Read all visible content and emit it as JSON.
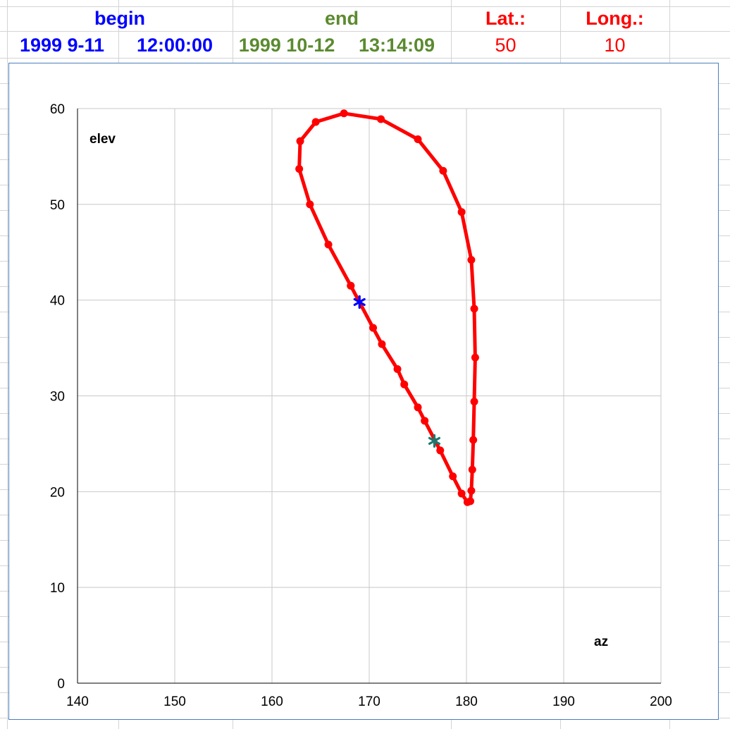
{
  "header": {
    "begin_label": "begin",
    "end_label": "end",
    "lat_label": "Lat.:",
    "long_label": "Long.:",
    "begin_date": "1999  9-11",
    "begin_time": "12:00:00",
    "end_date": "1999  10-12",
    "end_time": "13:14:09",
    "lat_value": "50",
    "long_value": "10"
  },
  "colors": {
    "begin": "#0000ff",
    "end": "#5b8a2f",
    "lat_long": "#ff0000",
    "series": "#ff0000",
    "begin_marker": "#0000ff",
    "end_marker": "#1a7a72",
    "plot_border": "#4a7ebb"
  },
  "chart_data": {
    "type": "scatter",
    "xlabel": "az",
    "ylabel": "elev",
    "xlim": [
      140,
      200
    ],
    "ylim": [
      0,
      60
    ],
    "xticks": [
      140,
      150,
      160,
      170,
      180,
      190,
      200
    ],
    "yticks": [
      0,
      10,
      20,
      30,
      40,
      50,
      60
    ],
    "grid": true,
    "series": [
      {
        "points": [
          [
            168.1,
            41.5
          ],
          [
            170.4,
            37.1
          ],
          [
            171.3,
            35.4
          ],
          [
            172.9,
            32.8
          ],
          [
            173.6,
            31.2
          ],
          [
            175.0,
            28.8
          ],
          [
            175.7,
            27.4
          ],
          [
            177.3,
            24.3
          ],
          [
            178.6,
            21.6
          ],
          [
            179.5,
            19.8
          ],
          [
            180.1,
            18.9
          ],
          [
            180.4,
            19.0
          ],
          [
            180.5,
            20.1
          ],
          [
            180.6,
            22.3
          ],
          [
            180.7,
            25.4
          ],
          [
            180.8,
            29.4
          ],
          [
            180.9,
            34.0
          ],
          [
            180.8,
            39.1
          ],
          [
            180.5,
            44.2
          ],
          [
            179.5,
            49.2
          ],
          [
            177.6,
            53.5
          ],
          [
            175.0,
            56.8
          ],
          [
            171.2,
            58.9
          ],
          [
            167.4,
            59.5
          ],
          [
            164.5,
            58.6
          ],
          [
            162.9,
            56.6
          ],
          [
            162.8,
            53.7
          ],
          [
            163.9,
            50.0
          ],
          [
            165.8,
            45.8
          ],
          [
            168.1,
            41.5
          ]
        ]
      }
    ],
    "markers": [
      {
        "name": "begin",
        "x": 169.0,
        "y": 39.8
      },
      {
        "name": "end",
        "x": 176.7,
        "y": 25.3
      }
    ]
  }
}
